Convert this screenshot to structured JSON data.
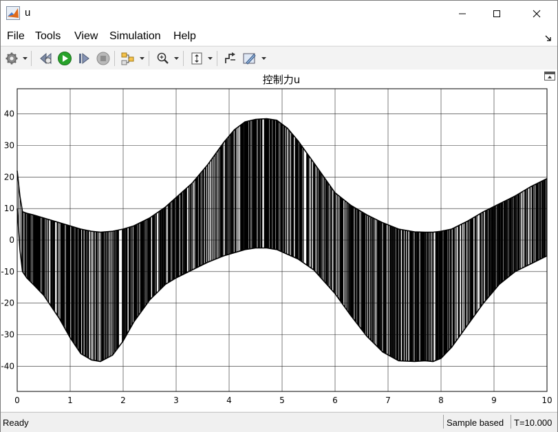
{
  "window": {
    "title": "u"
  },
  "menu": {
    "items": [
      "File",
      "Tools",
      "View",
      "Simulation",
      "Help"
    ]
  },
  "toolbar": {
    "buttons": [
      "gear-icon",
      "restore-icon",
      "run-icon",
      "step-forward-icon",
      "stop-icon",
      "signal-highlight-icon",
      "zoom-icon",
      "fit-to-view-icon",
      "cursor-measurement-icon",
      "style-icon"
    ]
  },
  "colors": {
    "trace": "#000000",
    "grid": "#262626",
    "play": "#27a22a"
  },
  "chart_data": {
    "type": "line",
    "title": "控制力u",
    "xlabel": "",
    "ylabel": "",
    "xlim": [
      0,
      10
    ],
    "ylim": [
      -48,
      48
    ],
    "xticks": [
      0,
      1,
      2,
      3,
      4,
      5,
      6,
      7,
      8,
      9,
      10
    ],
    "yticks": [
      -40,
      -30,
      -20,
      -10,
      0,
      10,
      20,
      30,
      40
    ],
    "grid": true,
    "legend": "none",
    "series": [
      {
        "description_of_signal": "chattering control signal oscillating between an upper and a lower envelope",
        "upper_envelope": {
          "x": [
            0,
            0.05,
            0.1,
            0.18,
            0.3,
            0.5,
            0.8,
            1.0,
            1.2,
            1.4,
            1.57,
            1.8,
            2.0,
            2.2,
            2.5,
            2.8,
            3.0,
            3.3,
            3.6,
            3.9,
            4.1,
            4.3,
            4.5,
            4.71,
            4.9,
            5.1,
            5.3,
            5.6,
            6.0,
            6.3,
            6.6,
            6.9,
            7.2,
            7.5,
            7.7,
            7.85,
            8.0,
            8.2,
            8.5,
            8.8,
            9.1,
            9.4,
            9.7,
            10.0
          ],
          "y": [
            22,
            14,
            9,
            8.5,
            8,
            7,
            5.5,
            4.5,
            3.5,
            2.8,
            2.5,
            2.8,
            3.5,
            4.5,
            7,
            10.5,
            13.5,
            18,
            24,
            31,
            35,
            37.5,
            38.3,
            38.5,
            38,
            35.5,
            31.5,
            24.5,
            15,
            11,
            8,
            5.5,
            3.5,
            2.6,
            2.5,
            2.5,
            2.8,
            3.5,
            6,
            9,
            11.5,
            14,
            17,
            19.5
          ]
        },
        "lower_envelope": {
          "x": [
            0,
            0.05,
            0.1,
            0.18,
            0.3,
            0.5,
            0.8,
            1.0,
            1.2,
            1.4,
            1.57,
            1.8,
            2.0,
            2.2,
            2.5,
            2.8,
            3.0,
            3.3,
            3.6,
            3.9,
            4.1,
            4.3,
            4.5,
            4.71,
            4.9,
            5.1,
            5.3,
            5.6,
            6.0,
            6.3,
            6.6,
            6.9,
            7.2,
            7.5,
            7.7,
            7.85,
            8.0,
            8.2,
            8.5,
            8.8,
            9.1,
            9.4,
            9.7,
            10.0
          ],
          "y": [
            10,
            -3,
            -10,
            -12,
            -14,
            -17.5,
            -25,
            -31,
            -36,
            -38,
            -38.5,
            -36.5,
            -32,
            -26,
            -19,
            -14,
            -12,
            -9.5,
            -7,
            -5,
            -4,
            -3,
            -2.5,
            -2.5,
            -3,
            -4.5,
            -6,
            -9.5,
            -17,
            -24,
            -30.5,
            -35.5,
            -38.3,
            -38.5,
            -38.3,
            -38.5,
            -37.5,
            -34,
            -27,
            -20,
            -14,
            -10,
            -7.5,
            -5
          ]
        }
      }
    ]
  },
  "status": {
    "ready": "Ready",
    "sample_mode": "Sample based",
    "time": "T=10.000"
  }
}
